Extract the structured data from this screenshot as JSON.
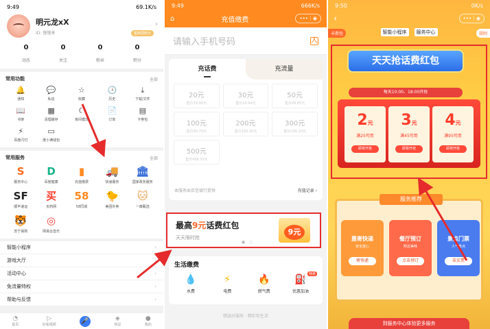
{
  "panel1": {
    "status": {
      "time": "9:49",
      "net": "69.1K/s"
    },
    "profile": {
      "name": "明元龙xX",
      "sub": "ID: 慢慢来",
      "badge": "签到领积分"
    },
    "stats": [
      {
        "v": "0",
        "l": "动态"
      },
      {
        "v": "0",
        "l": "关注"
      },
      {
        "v": "0",
        "l": "粉丝"
      },
      {
        "v": "0",
        "l": "积分"
      }
    ],
    "common": {
      "title": "常用功能",
      "all": "全部",
      "items": [
        {
          "i": "🔔",
          "l": "通知"
        },
        {
          "i": "💬",
          "l": "私信"
        },
        {
          "i": "☆",
          "l": "收藏"
        },
        {
          "i": "🕒",
          "l": "历史"
        },
        {
          "i": "⤓",
          "l": "下载/文件"
        },
        {
          "i": "📖",
          "l": "书架"
        },
        {
          "i": "▦",
          "l": "清理缓存"
        },
        {
          "i": "☾",
          "l": "夜间模式"
        },
        {
          "i": "📄",
          "l": "订单"
        },
        {
          "i": "▤",
          "l": "卡券包"
        },
        {
          "i": "⚡",
          "l": "百度闪付"
        },
        {
          "i": "▭",
          "l": "度小满钱包"
        }
      ]
    },
    "services": {
      "title": "常用服务",
      "all": "全部",
      "items": [
        {
          "i": "S",
          "c": "#ff6a1f",
          "l": "服务中心"
        },
        {
          "i": "D",
          "c": "#18b38a",
          "l": "百度健康"
        },
        {
          "i": "▮",
          "c": "#ff8a1f",
          "l": "充值缴费"
        },
        {
          "i": "🚚",
          "c": "#ff5a2b",
          "l": "快递服务"
        },
        {
          "i": "🏛",
          "c": "#3b6fd8",
          "l": "国家政务服务"
        },
        {
          "i": "SF",
          "c": "#222",
          "l": "顺丰速运"
        },
        {
          "i": "买",
          "c": "#ff3c2b",
          "l": "买药网"
        },
        {
          "i": "58",
          "c": "#ff8a1f",
          "l": "58同城"
        },
        {
          "i": "🐤",
          "c": "#f5b800",
          "l": "美团外卖"
        },
        {
          "i": "🐱",
          "c": "#e8a45a",
          "l": "一森甄选"
        },
        {
          "i": "🐯",
          "c": "#e8403a",
          "l": "苏宁易购"
        },
        {
          "i": "◎",
          "c": "#e8403a",
          "l": "网易云音乐"
        }
      ]
    },
    "rows": [
      "智能小程序",
      "游戏大厅",
      "活动中心",
      "免流量特权",
      "帮助与反馈"
    ],
    "tabs": [
      {
        "i": "◔",
        "l": "首页"
      },
      {
        "i": "▷",
        "l": "好看视频"
      },
      {
        "i": "🎤",
        "l": ""
      },
      {
        "i": "◈",
        "l": "热议"
      },
      {
        "i": "●",
        "l": "我的"
      }
    ]
  },
  "panel2": {
    "status": {
      "time": "9:49",
      "net": "666K/s"
    },
    "title": "充值缴费",
    "phone_placeholder": "请输入手机号码",
    "tabs": [
      "充话费",
      "充流量"
    ],
    "amounts": [
      {
        "v": "20元",
        "p": "售价19.96元"
      },
      {
        "v": "30元",
        "p": "售价29.94元"
      },
      {
        "v": "50元",
        "p": "售价49.85元"
      },
      {
        "v": "100元",
        "p": "售价99.70元"
      },
      {
        "v": "200元",
        "p": "售价199.40元"
      },
      {
        "v": "300元",
        "p": "售价299.10元"
      },
      {
        "v": "500元",
        "p": "售价498.50元"
      }
    ],
    "provider": "本服务由百信银行提供",
    "record": "充值记录",
    "banner": {
      "pre": "最高",
      "hl": "9元",
      "post": "话费红包",
      "sub": "天天限时抢",
      "coin": "9元"
    },
    "life": {
      "title": "生活缴费",
      "items": [
        {
          "i": "💧",
          "c": "#2d8cf0",
          "l": "水费"
        },
        {
          "i": "⚡",
          "c": "#f5b800",
          "l": "电费"
        },
        {
          "i": "🔥",
          "c": "#ff6a1f",
          "l": "燃气费"
        },
        {
          "i": "⛽",
          "c": "#ff8a1f",
          "l": "优惠加油"
        }
      ],
      "hot": "特惠"
    },
    "footer": "精选好服务 · 精彩你生活"
  },
  "panel3": {
    "status": {
      "time": "9:50",
      "net": "0K/s"
    },
    "tabs": [
      "智能小程序",
      "服务中心"
    ],
    "kbq": "卡券包",
    "rule": "规则",
    "title": "天天抢话费红包",
    "time": "每天10:00、18:00开抢",
    "tickets": [
      {
        "n": "2",
        "c": "满25可用",
        "b": "即将开抢"
      },
      {
        "n": "3",
        "c": "满45可用",
        "b": "即将开抢"
      },
      {
        "n": "4",
        "c": "满95可用",
        "b": "即将开抢"
      }
    ],
    "service_title": "服务推荐",
    "services": [
      {
        "t": "惠寄快递",
        "s": "安全放心",
        "b": "寄快递",
        "c": "#ff9a3a"
      },
      {
        "t": "餐厅预订",
        "s": "附近美味",
        "b": "点击预订",
        "c": "#ff6a4a"
      },
      {
        "t": "景点门票",
        "s": "人气景点",
        "b": "去买票",
        "c": "#4a7cf0"
      }
    ],
    "bottom": "到服务中心体验更多服务"
  }
}
